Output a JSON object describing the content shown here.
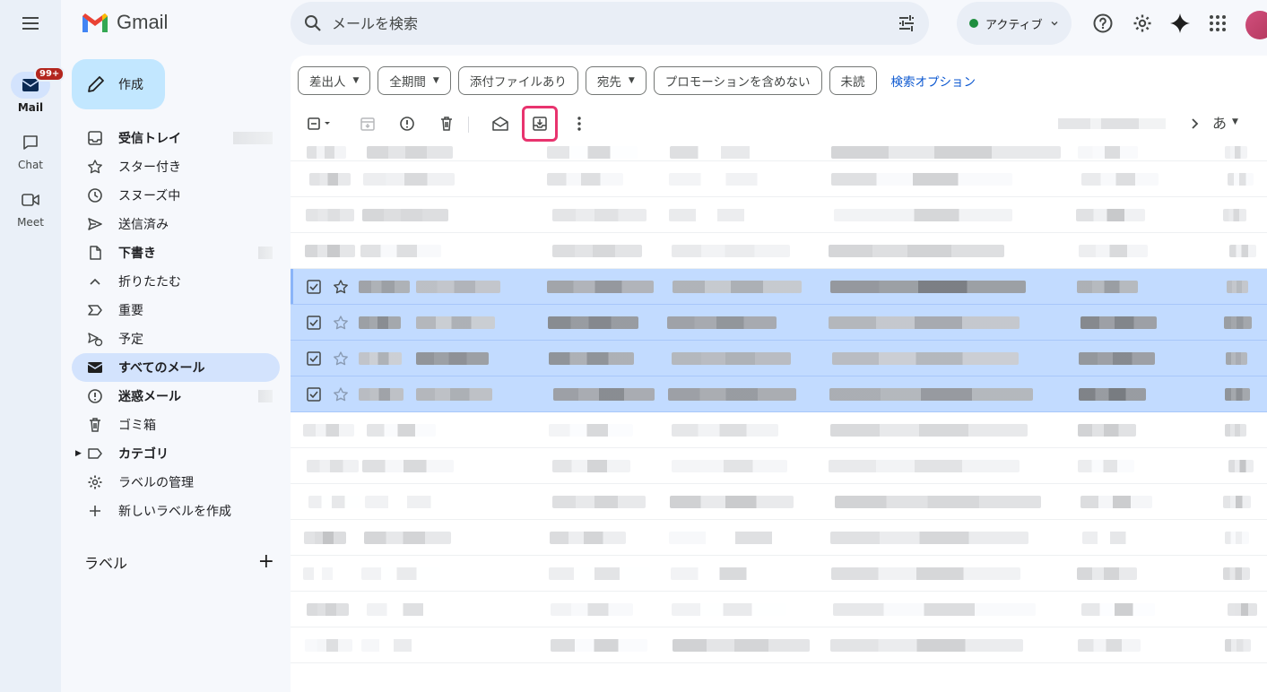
{
  "app": {
    "name": "Gmail"
  },
  "rail": {
    "items": [
      {
        "label": "Mail",
        "badge": "99+"
      },
      {
        "label": "Chat"
      },
      {
        "label": "Meet"
      }
    ]
  },
  "compose": {
    "label": "作成"
  },
  "nav": {
    "inbox": "受信トレイ",
    "starred": "スター付き",
    "snoozed": "スヌーズ中",
    "sent": "送信済み",
    "drafts": "下書き",
    "collapse": "折りたたむ",
    "important": "重要",
    "scheduled": "予定",
    "all_mail": "すべてのメール",
    "spam": "迷惑メール",
    "trash": "ゴミ箱",
    "categories": "カテゴリ",
    "manage_labels": "ラベルの管理",
    "create_label": "新しいラベルを作成"
  },
  "labels": {
    "title": "ラベル",
    "add_symbol": "+"
  },
  "search": {
    "placeholder": "メールを検索"
  },
  "status": {
    "label": "アクティブ",
    "color": "#1e8e3e"
  },
  "filters": {
    "chips": [
      "差出人",
      "全期間",
      "添付ファイルあり",
      "宛先",
      "プロモーションを含めない",
      "未読"
    ],
    "advanced_link": "検索オプション"
  },
  "toolbar": {
    "icons": [
      "select-checkbox-icon",
      "archive-icon",
      "report-spam-icon",
      "delete-icon",
      "mark-unread-icon",
      "move-to-inbox-icon",
      "more-vert-icon"
    ],
    "highlighted": "move-to-inbox-icon",
    "input_method": "あ"
  },
  "colors": {
    "accent": "#0b57d0",
    "compose_bg": "#c2e7ff",
    "active_nav": "#d3e3fd",
    "selected_row": "#c2dbff",
    "highlight_box": "#e8336e",
    "badge": "#b3261e"
  },
  "list": {
    "selected_rows": [
      4,
      5,
      6,
      7
    ],
    "row_count": 15
  }
}
